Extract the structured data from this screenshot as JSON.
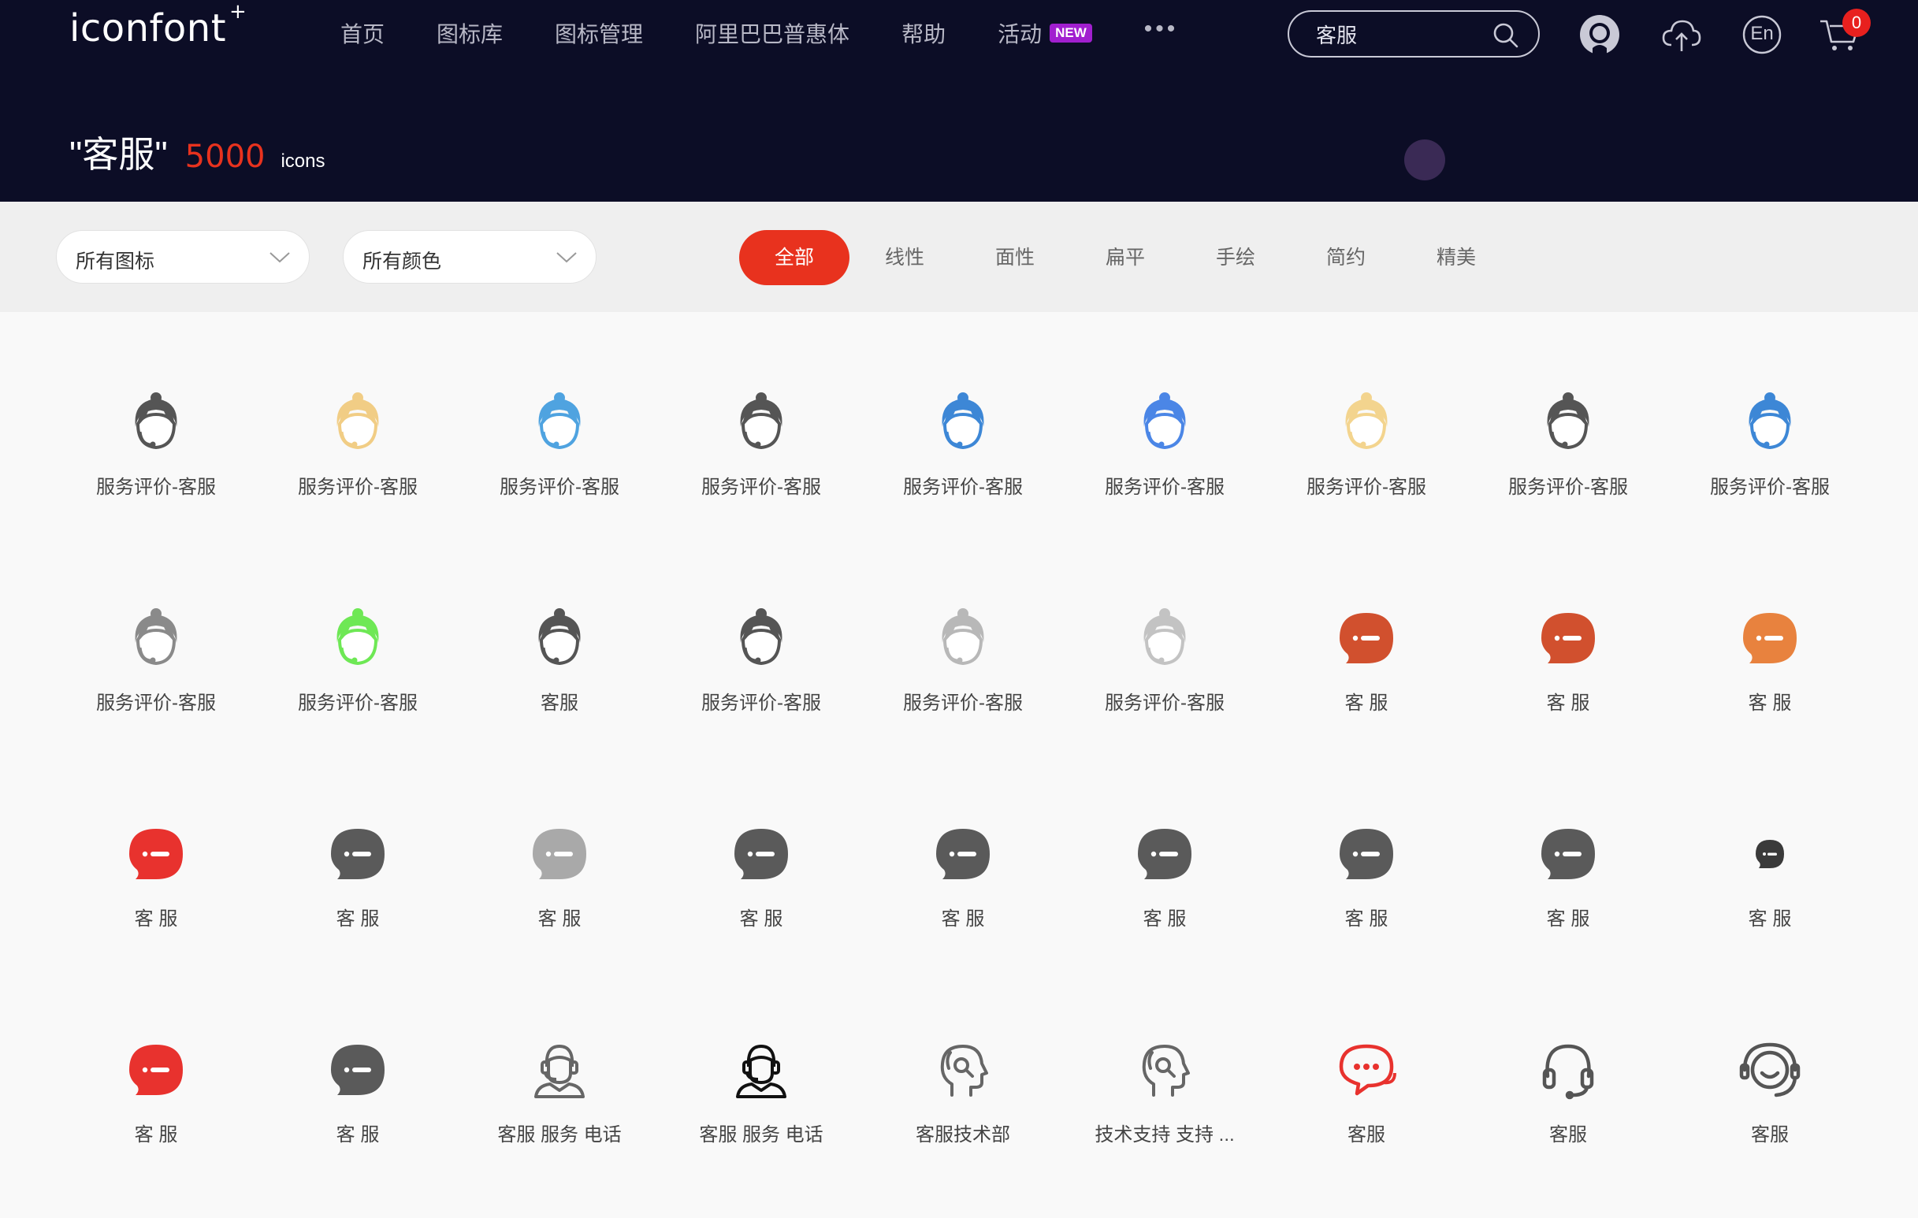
{
  "brand": {
    "logo_text": "iconfont",
    "logo_plus": "+"
  },
  "nav": {
    "items": [
      "首页",
      "图标库",
      "图标管理",
      "阿里巴巴普惠体",
      "帮助",
      "活动"
    ],
    "new_badge": "NEW",
    "more": "•••"
  },
  "search": {
    "value": "客服",
    "icon": "search-icon"
  },
  "header_icons": [
    "github-icon",
    "upload-cloud-icon",
    "language-icon",
    "cart-icon"
  ],
  "lang_label": "En",
  "cart_count": "0",
  "title": {
    "query": "\"客服\"",
    "count": "5000",
    "unit": "icons"
  },
  "filters": {
    "icon_type": "所有图标",
    "color": "所有颜色",
    "tabs": [
      "全部",
      "线性",
      "面性",
      "扁平",
      "手绘",
      "简约",
      "精美"
    ],
    "active_tab": 0
  },
  "colors": {
    "accent": "#e8321e",
    "header_bg": "#0c0d26",
    "new_badge": "#a11fcf"
  },
  "icons": [
    {
      "label": "服务评价-客服",
      "type": "agent",
      "color": "#555555"
    },
    {
      "label": "服务评价-客服",
      "type": "agent",
      "color": "#f1cd85"
    },
    {
      "label": "服务评价-客服",
      "type": "agent",
      "color": "#4fa3e0"
    },
    {
      "label": "服务评价-客服",
      "type": "agent",
      "color": "#555555"
    },
    {
      "label": "服务评价-客服",
      "type": "agent",
      "color": "#3d87d6"
    },
    {
      "label": "服务评价-客服",
      "type": "agent",
      "color": "#4b86e6"
    },
    {
      "label": "服务评价-客服",
      "type": "agent",
      "color": "#f3d48e"
    },
    {
      "label": "服务评价-客服",
      "type": "agent",
      "color": "#555555"
    },
    {
      "label": "服务评价-客服",
      "type": "agent",
      "color": "#3d87d6"
    },
    {
      "label": "服务评价-客服",
      "type": "agent",
      "color": "#8a8a8a"
    },
    {
      "label": "服务评价-客服",
      "type": "agent",
      "color": "#6ee855"
    },
    {
      "label": "客服",
      "type": "agent",
      "color": "#555555"
    },
    {
      "label": "服务评价-客服",
      "type": "agent",
      "color": "#555555"
    },
    {
      "label": "服务评价-客服",
      "type": "agent",
      "color": "#b8b8b8"
    },
    {
      "label": "服务评价-客服",
      "type": "agent",
      "color": "#c3c3c3"
    },
    {
      "label": "客 服",
      "type": "bubble",
      "color": "#d1502e"
    },
    {
      "label": "客 服",
      "type": "bubble",
      "color": "#d1502e"
    },
    {
      "label": "客 服",
      "type": "bubble",
      "color": "#e8823e"
    },
    {
      "label": "客 服",
      "type": "bubble",
      "color": "#e8322e"
    },
    {
      "label": "客 服",
      "type": "bubble",
      "color": "#5a5a5a"
    },
    {
      "label": "客 服",
      "type": "bubble",
      "color": "#a9a9a9"
    },
    {
      "label": "客 服",
      "type": "bubble",
      "color": "#5a5a5a"
    },
    {
      "label": "客 服",
      "type": "bubble",
      "color": "#5a5a5a"
    },
    {
      "label": "客 服",
      "type": "bubble",
      "color": "#5a5a5a"
    },
    {
      "label": "客 服",
      "type": "bubble",
      "color": "#5a5a5a"
    },
    {
      "label": "客 服",
      "type": "bubble",
      "color": "#5a5a5a"
    },
    {
      "label": "客 服",
      "type": "bubble-small",
      "color": "#3a3a3a"
    },
    {
      "label": "客 服",
      "type": "bubble",
      "color": "#e8322e"
    },
    {
      "label": "客 服",
      "type": "bubble",
      "color": "#5a5a5a"
    },
    {
      "label": "客服 服务 电话",
      "type": "headset-person",
      "color": "#666666"
    },
    {
      "label": "客服 服务 电话",
      "type": "headset-person",
      "color": "#111111"
    },
    {
      "label": "客服技术部",
      "type": "head-search",
      "color": "#666666"
    },
    {
      "label": "技术支持 支持 ...",
      "type": "head-search",
      "color": "#666666"
    },
    {
      "label": "客服",
      "type": "chat-dots",
      "color": "#e8322e"
    },
    {
      "label": "客服",
      "type": "headphones",
      "color": "#555555"
    },
    {
      "label": "客服",
      "type": "headset-smile",
      "color": "#555555"
    }
  ]
}
